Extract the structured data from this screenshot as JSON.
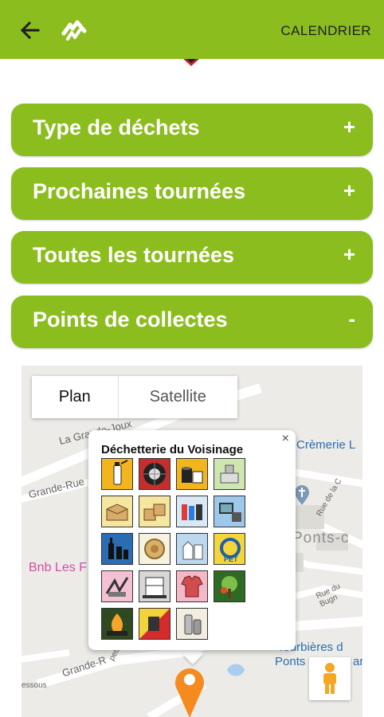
{
  "header": {
    "title_action": "CALENDRIER",
    "back_icon": "arrow-left-icon",
    "logo_icon": "m-logo-icon",
    "bar_color": "#8cbd1f"
  },
  "sections": [
    {
      "title": "Type de déchets",
      "sign": "+"
    },
    {
      "title": "Prochaines tournées",
      "sign": "+"
    },
    {
      "title": "Toutes les tournées",
      "sign": "+"
    },
    {
      "title": "Points de collectes",
      "sign": "-"
    }
  ],
  "map": {
    "type_control": {
      "plan": "Plan",
      "satellite": "Satellite"
    },
    "labels": {
      "road_grande_joux": "La Grande-Joux",
      "road_grande_rue": "Grande-Rue",
      "road_grande_rue_2": "Grande-R",
      "road_la_c": "Rue de la C",
      "road_bugn": "Rue du Bugn",
      "road_dessous": "essous",
      "road_petit": "petit",
      "place_cremerie": "Crèmerie L",
      "place_bnb": "Bnb Les F",
      "place_ponts": "Ponts-c",
      "place_tourbieres_1": "Tourbières d",
      "place_tourbieres_2": "Ponts",
      "place_tourbieres_3": "ar"
    },
    "popup": {
      "title": "Déchetterie du Voisinage",
      "close": "×",
      "icons": [
        "spray-can-icon",
        "tire-icon",
        "paint-cans-icon",
        "kitchen-utensils-icon",
        "cardboard-box-icon",
        "cardboard-boxes-icon",
        "batteries-icon",
        "electronics-icon",
        "glass-bottles-icon",
        "coffee-capsule-icon",
        "plastic-bottles-icon",
        "pet-recycling-icon",
        "scrap-metal-icon",
        "appliances-icon",
        "textiles-icon",
        "green-waste-icon",
        "fire-hazard-icon",
        "waste-oil-icon",
        "aluminium-cans-icon"
      ]
    },
    "pegman_icon": "pegman-icon",
    "marker_icon": "location-pin-icon",
    "marker_color": "#f58b1f"
  }
}
